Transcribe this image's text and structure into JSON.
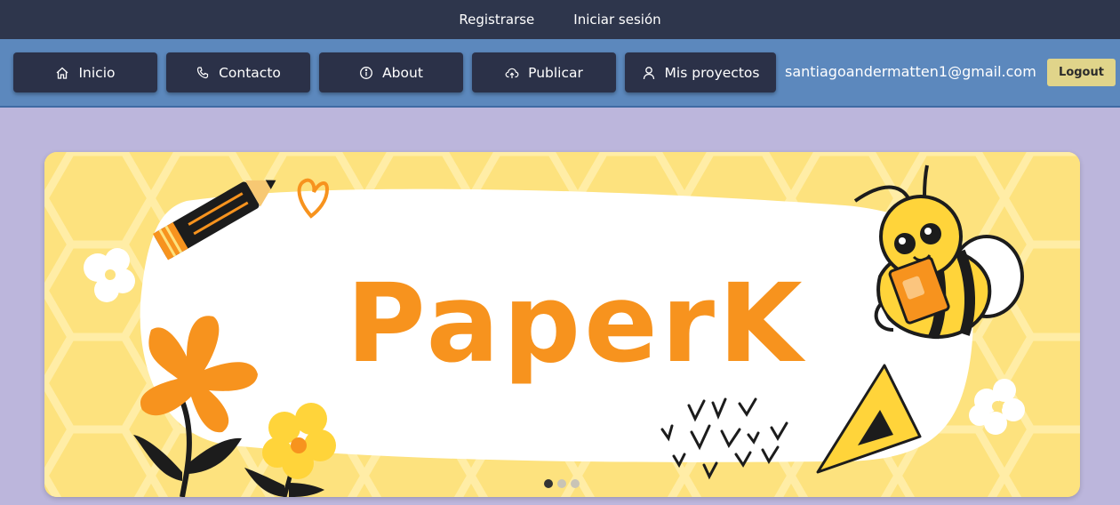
{
  "topbar": {
    "register_label": "Registrarse",
    "login_label": "Iniciar sesión"
  },
  "nav": {
    "items": [
      {
        "label": "Inicio",
        "icon": "home-icon"
      },
      {
        "label": "Contacto",
        "icon": "phone-icon"
      },
      {
        "label": "About",
        "icon": "info-icon"
      },
      {
        "label": "Publicar",
        "icon": "cloud-upload-icon"
      },
      {
        "label": "Mis proyectos",
        "icon": "user-icon"
      }
    ],
    "user_email": "santiagoandermatten1@gmail.com",
    "logout_label": "Logout"
  },
  "carousel": {
    "banner_title": "PaperK",
    "slide_count": 3,
    "active_slide": 1
  },
  "colors": {
    "topbar_bg": "#2e364c",
    "navbar_bg": "#5c88bd",
    "button_bg": "#2b3148",
    "page_bg": "#bcb6dc",
    "banner_bg": "#fde27e",
    "accent_orange": "#f7931e",
    "logout_bg": "#e0d48a"
  }
}
